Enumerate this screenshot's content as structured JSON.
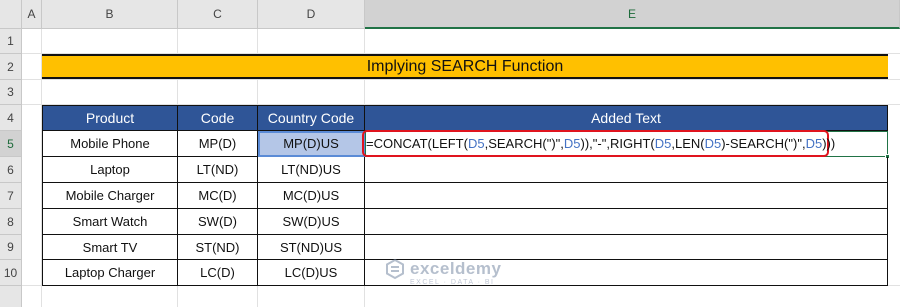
{
  "columns": [
    "A",
    "B",
    "C",
    "D",
    "E"
  ],
  "rows": [
    "1",
    "2",
    "3",
    "4",
    "5",
    "6",
    "7",
    "8",
    "9",
    "10"
  ],
  "title": "Implying SEARCH Function",
  "table": {
    "headers": [
      "Product",
      "Code",
      "Country Code",
      "Added Text"
    ],
    "rows": [
      {
        "product": "Mobile Phone",
        "code": "MP(D)",
        "country_code": "MP(D)US"
      },
      {
        "product": "Laptop",
        "code": "LT(ND)",
        "country_code": "LT(ND)US"
      },
      {
        "product": "Mobile Charger",
        "code": "MC(D)",
        "country_code": "MC(D)US"
      },
      {
        "product": "Smart Watch",
        "code": "SW(D)",
        "country_code": "SW(D)US"
      },
      {
        "product": "Smart TV",
        "code": "ST(ND)",
        "country_code": "ST(ND)US"
      },
      {
        "product": "Laptop Charger",
        "code": "LC(D)",
        "country_code": "LC(D)US"
      }
    ]
  },
  "formula": {
    "p1": "=CONCAT(LEFT(",
    "r1": "D5",
    "p2": ",SEARCH(\")\",",
    "r2": "D5",
    "p3": ")),\"-\",RIGHT(",
    "r3": "D5",
    "p4": ",LEN(",
    "r4": "D5",
    "p5": ")-SEARCH(\")\",",
    "r5": "D5",
    "p6": ")))"
  },
  "watermark": {
    "name": "exceldemy",
    "tagline": "EXCEL · DATA · BI"
  },
  "colors": {
    "header_fill": "#2f5597",
    "title_fill": "#ffc000",
    "selected_fill": "#b4c6e7",
    "formula_border": "#e0141e",
    "active_green": "#217346"
  }
}
